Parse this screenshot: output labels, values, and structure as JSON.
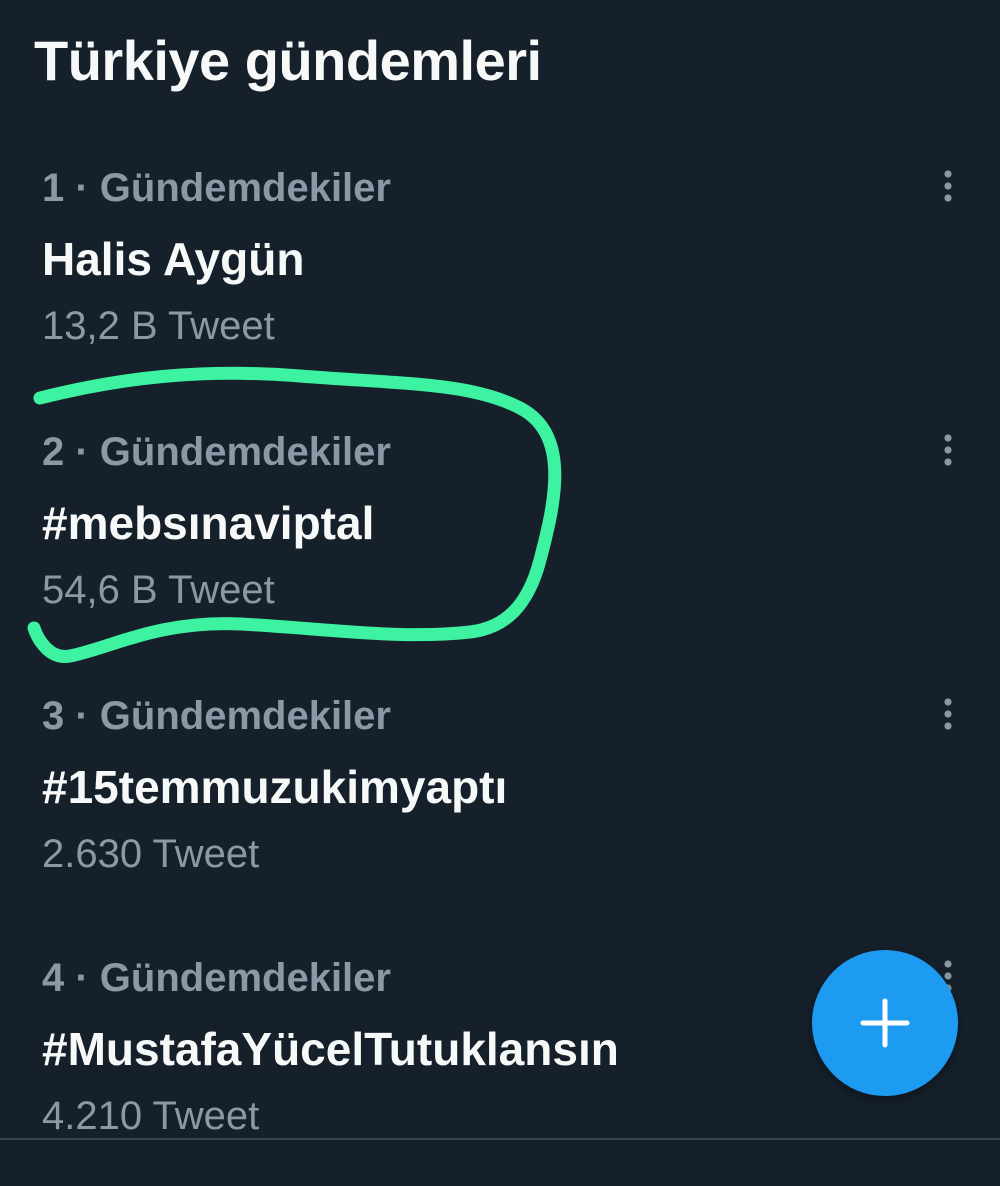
{
  "page_title": "Türkiye gündemleri",
  "trends": [
    {
      "meta": "1 · Gündemdekiler",
      "name": "Halis Aygün",
      "count": "13,2 B Tweet"
    },
    {
      "meta": "2 · Gündemdekiler",
      "name": "#mebsınaviptal",
      "count": "54,6 B Tweet"
    },
    {
      "meta": "3 · Gündemdekiler",
      "name": "#15temmuzukimyaptı",
      "count": "2.630 Tweet"
    },
    {
      "meta": "4 · Gündemdekiler",
      "name": "#MustafaYücelTutuklansın",
      "count": "4.210 Tweet"
    }
  ],
  "icons": {
    "more": "more-vertical-icon",
    "compose": "plus-icon"
  },
  "colors": {
    "background": "#15202b",
    "primary_text": "#f7f9f9",
    "secondary_text": "#8b98a5",
    "accent": "#1d9bf0",
    "highlight_marker": "#3df2a0"
  }
}
